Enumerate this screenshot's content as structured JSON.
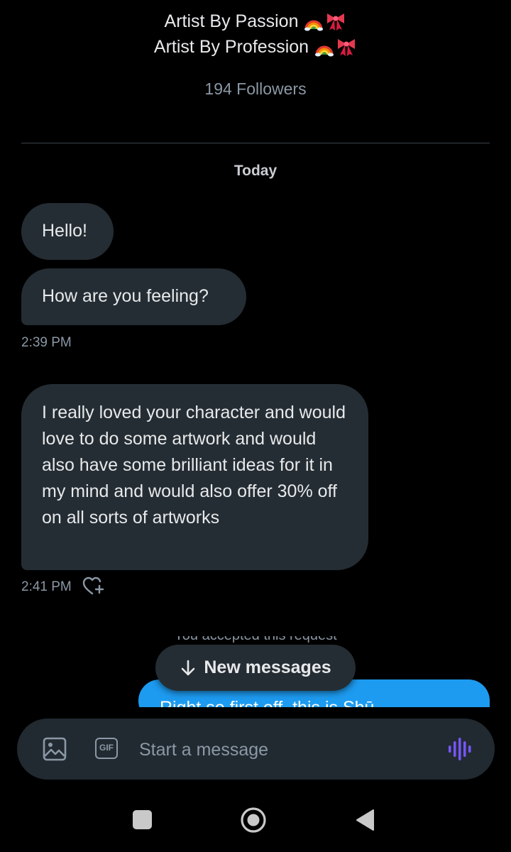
{
  "profile": {
    "bio_line1": "Artist By Passion",
    "bio_line2": "Artist By Profession",
    "bio_emojis": [
      "rainbow-emoji",
      "ribbon-emoji"
    ],
    "followers": "194 Followers"
  },
  "conversation": {
    "day_separator": "Today",
    "messages": [
      {
        "text": "Hello!"
      },
      {
        "text": "How are you feeling?"
      },
      {
        "timestamp": "2:39 PM"
      },
      {
        "text": "I really loved your character and would love to do some artwork and would also have some brilliant ideas for it in my mind and would also offer 30% off on all sorts of artworks"
      },
      {
        "timestamp": "2:41 PM"
      }
    ],
    "notice_partial": "You accepted this request",
    "own_message_partial": "Right so first off, this is Shū"
  },
  "new_messages_pill": {
    "label": "New messages"
  },
  "composer": {
    "placeholder": "Start a message",
    "gif_label": "GIF"
  },
  "colors": {
    "background": "#000000",
    "bubble_incoming": "#252d34",
    "bubble_outgoing": "#1d9bf0",
    "voice_accent": "#7856ff",
    "muted_text": "#8b98a5"
  }
}
